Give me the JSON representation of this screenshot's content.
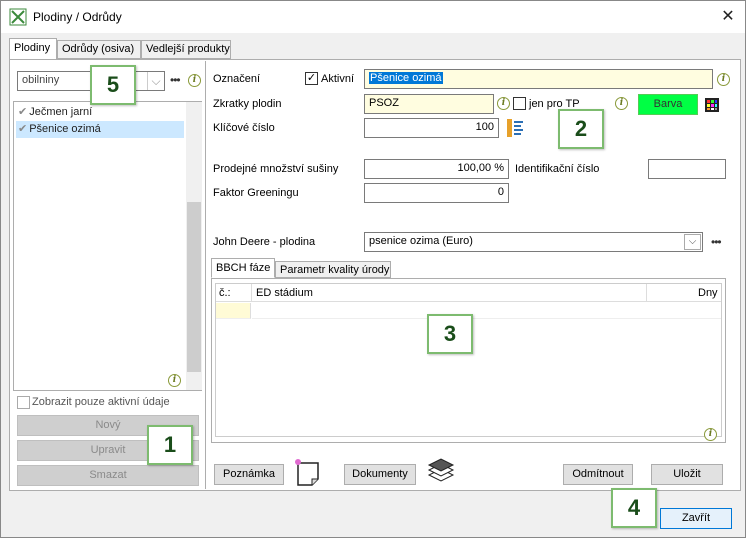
{
  "window": {
    "title": "Plodiny / Odrůdy",
    "close_symbol": "✕"
  },
  "tabs": [
    "Plodiny",
    "Odrůdy (osiva)",
    "Vedlejší produkty"
  ],
  "left": {
    "filter_value": "obilniny",
    "items": [
      {
        "label": "Ječmen jarní",
        "checked": true
      },
      {
        "label": "Pšenice ozimá",
        "checked": true,
        "selected": true
      }
    ],
    "show_active_label": "Zobrazit pouze aktivní údaje",
    "buttons": {
      "new": "Nový",
      "edit": "Upravit",
      "delete": "Smazat"
    }
  },
  "form": {
    "name_label": "Označení",
    "active_label": "Aktivní",
    "name_value": "Pšenice ozimá",
    "abbr_label": "Zkratky plodin",
    "abbr_value": "PSOZ",
    "tp_label": "jen pro TP",
    "color_label": "Barva",
    "color_value": "#00ff44",
    "key_label": "Klíčové číslo",
    "key_value": "100",
    "dry_label": "Prodejné množství sušiny",
    "dry_value": "100,00 %",
    "ident_label": "Identifikační číslo",
    "ident_value": "",
    "greening_label": "Faktor Greeningu",
    "greening_value": "0",
    "jd_label": "John Deere - plodina",
    "jd_value": "psenice ozima (Euro)"
  },
  "subtabs": [
    "BBCH fáze",
    "Parametr kvality úrody"
  ],
  "table": {
    "columns": [
      "č.:",
      "ED stádium",
      "Dny"
    ]
  },
  "bottom": {
    "note": "Poznámka",
    "documents": "Dokumenty",
    "reject": "Odmítnout",
    "save": "Uložit",
    "close": "Zavřít"
  },
  "callouts": [
    "1",
    "2",
    "3",
    "4",
    "5"
  ],
  "info_glyph": "i",
  "dots": "•••"
}
